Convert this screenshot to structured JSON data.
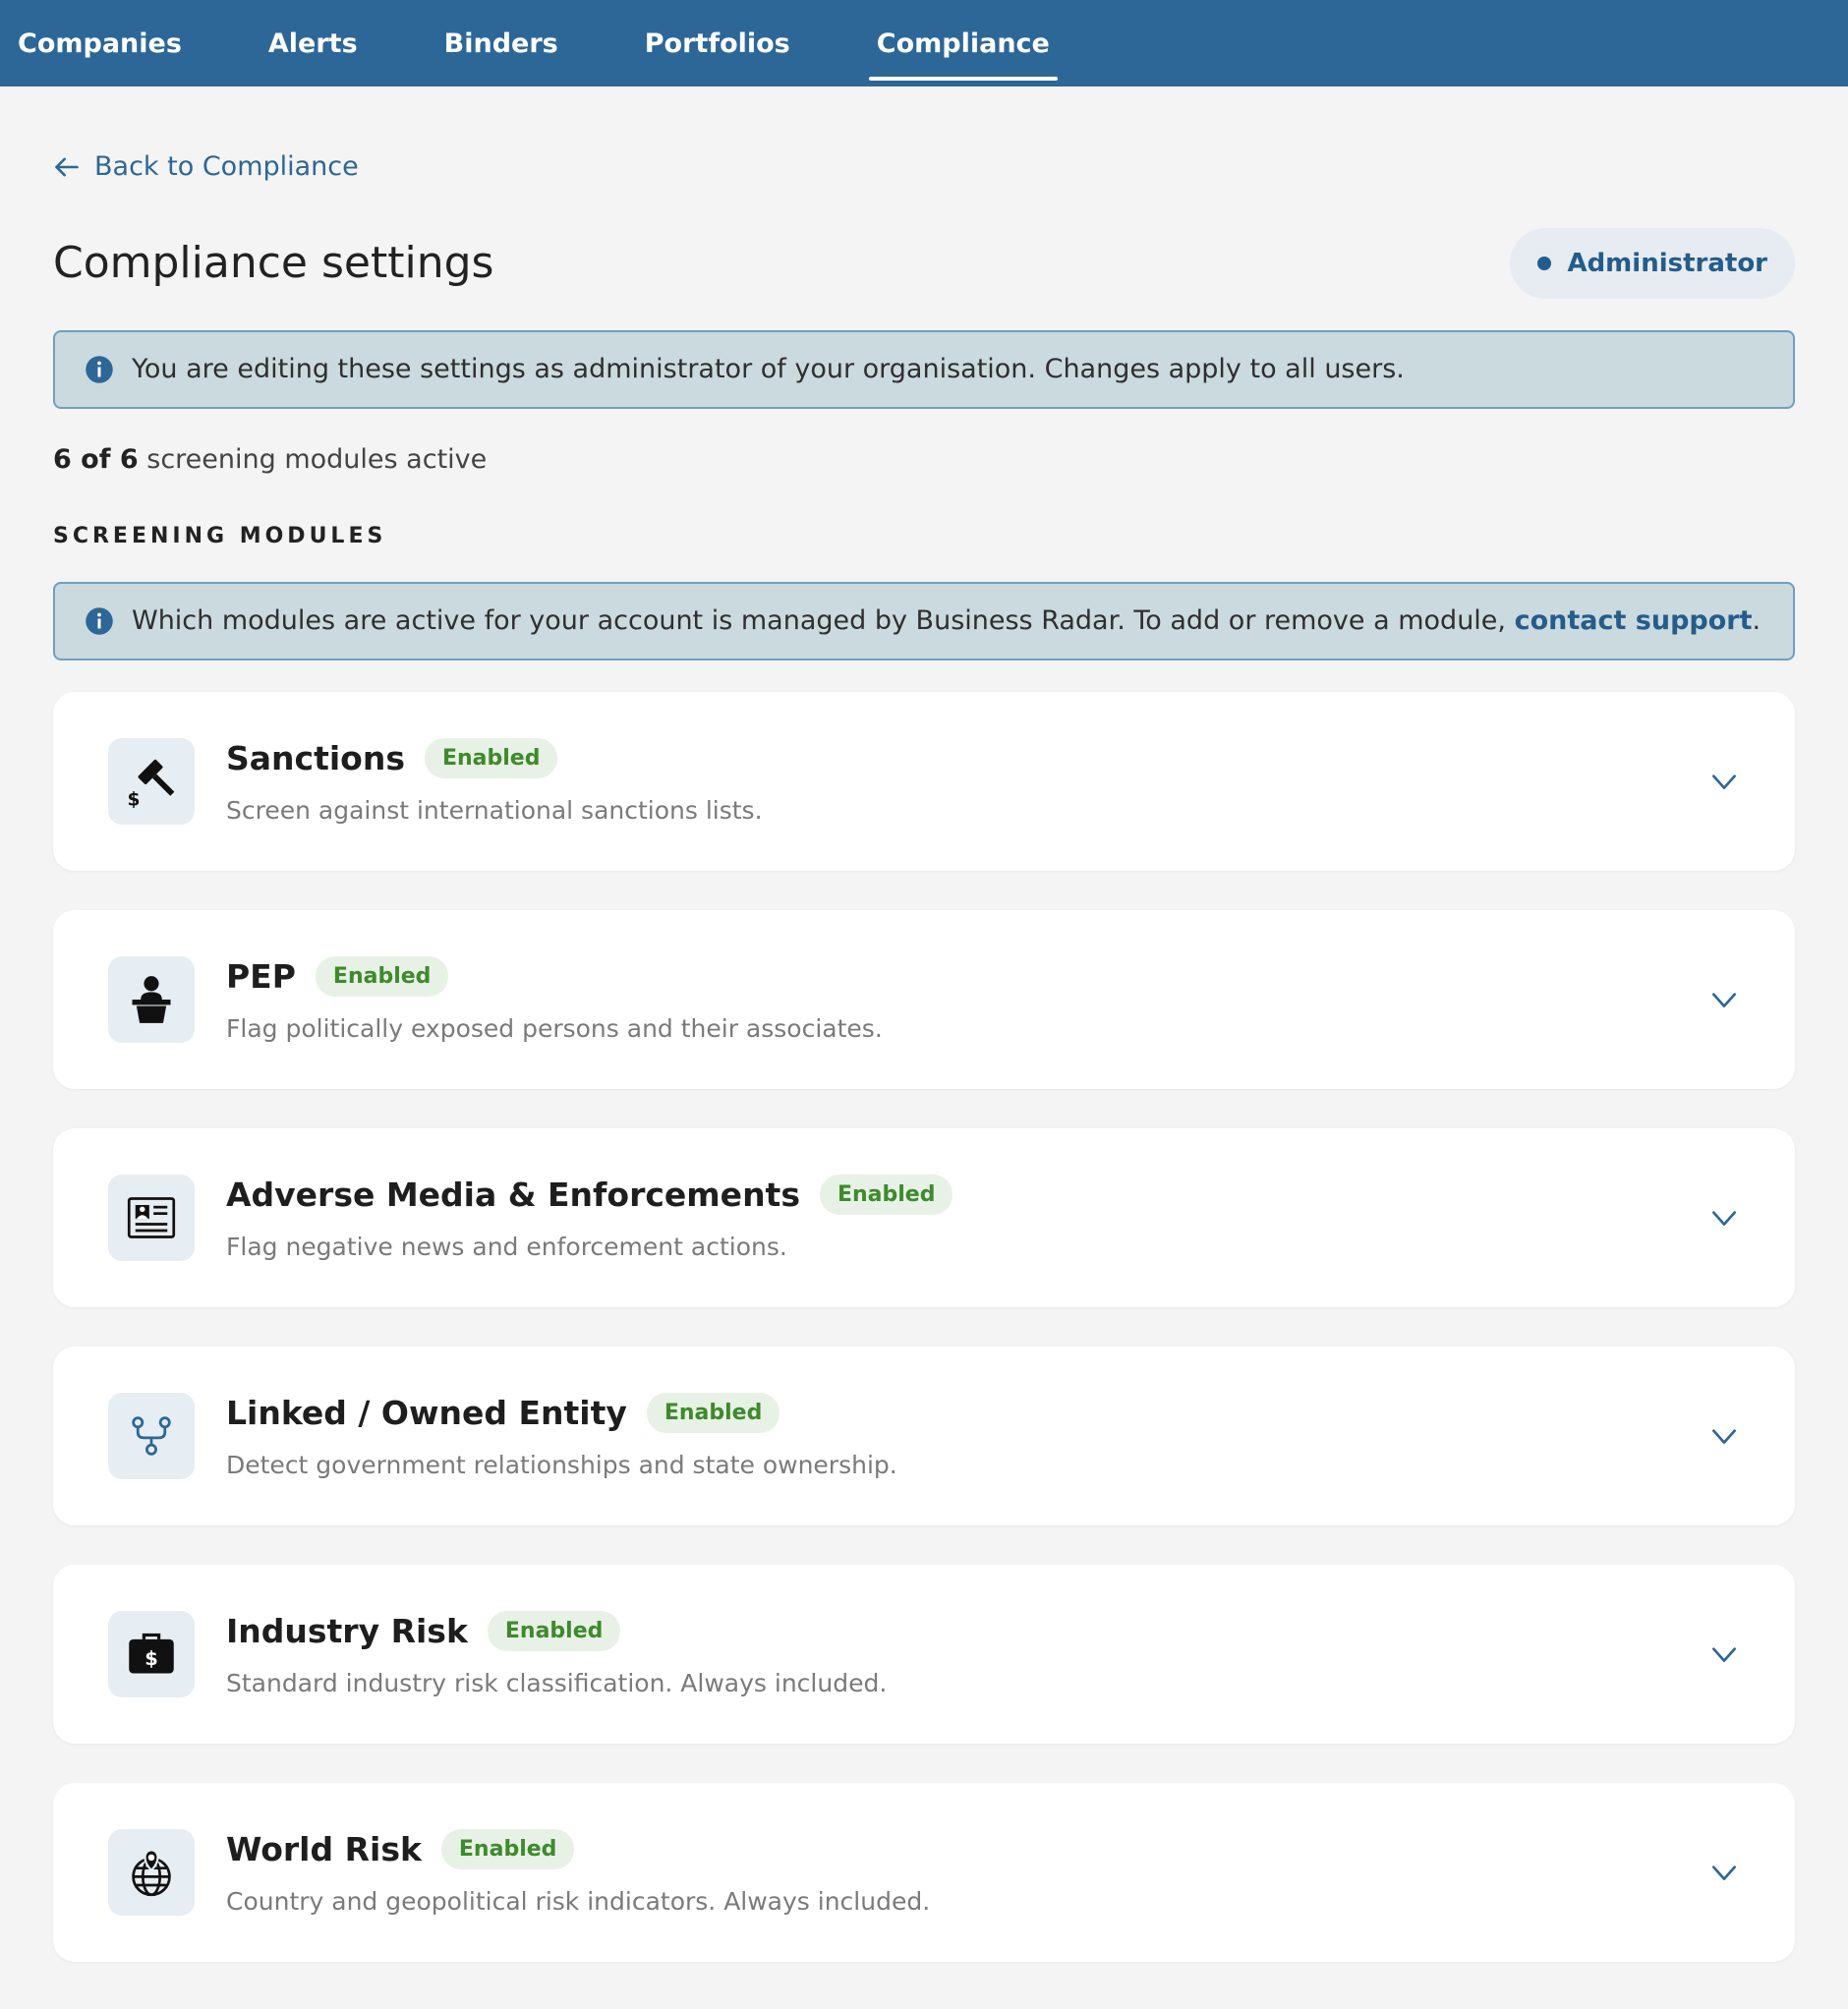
{
  "nav": {
    "tabs": [
      {
        "label": "Companies"
      },
      {
        "label": "Alerts"
      },
      {
        "label": "Binders"
      },
      {
        "label": "Portfolios"
      },
      {
        "label": "Compliance"
      }
    ],
    "active_tab": "Compliance"
  },
  "back_link": {
    "label": "Back to Compliance",
    "icon": "arrow-left-icon"
  },
  "page": {
    "title": "Compliance settings"
  },
  "role": {
    "label": "Administrator"
  },
  "admin_notice": {
    "text": "You are editing these settings as administrator of your organisation. Changes apply to all users.",
    "icon": "info-icon"
  },
  "summary": {
    "count_bold": "6 of 6",
    "count_rest": " screening modules active"
  },
  "section": {
    "heading": "SCREENING MODULES"
  },
  "modules_notice": {
    "text": "Which modules are active for your account is managed by Business Radar. To add or remove a module, ",
    "link": "contact support",
    "after": "."
  },
  "modules": [
    {
      "name": "Sanctions",
      "status": "Enabled",
      "description": "Screen against international sanctions lists.",
      "icon": "gavel-dollar-icon"
    },
    {
      "name": "PEP",
      "status": "Enabled",
      "description": "Flag politically exposed persons and their associates.",
      "icon": "person-podium-icon"
    },
    {
      "name": "Adverse Media & Enforcements",
      "status": "Enabled",
      "description": "Flag negative news and enforcement actions.",
      "icon": "newspaper-icon"
    },
    {
      "name": "Linked / Owned Entity",
      "status": "Enabled",
      "description": "Detect government relationships and state ownership.",
      "icon": "network-fork-icon"
    },
    {
      "name": "Industry Risk",
      "status": "Enabled",
      "description": "Standard industry risk classification. Always included.",
      "icon": "briefcase-dollar-icon"
    },
    {
      "name": "World Risk",
      "status": "Enabled",
      "description": "Country and geopolitical risk indicators. Always included.",
      "icon": "globe-pin-icon"
    }
  ],
  "colors": {
    "nav_bg": "#2d6797",
    "accent": "#245c8b",
    "badge_bg": "#e8f1e6",
    "badge_text": "#3e8a2c",
    "notice_bg": "#cbdadf",
    "page_bg": "#f4f4f4"
  }
}
